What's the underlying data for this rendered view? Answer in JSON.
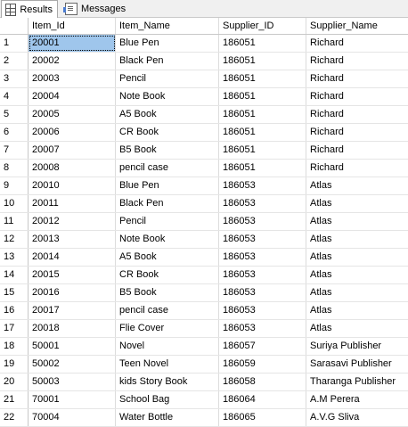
{
  "tabs": [
    {
      "label": "Results",
      "icon": "grid-icon",
      "active": true
    },
    {
      "label": "Messages",
      "icon": "messages-icon",
      "active": false
    }
  ],
  "table": {
    "columns": [
      "",
      "Item_Id",
      "Item_Name",
      "Supplier_ID",
      "Supplier_Name"
    ],
    "rows": [
      [
        "1",
        "20001",
        "Blue Pen",
        "186051",
        "Richard"
      ],
      [
        "2",
        "20002",
        "Black Pen",
        "186051",
        "Richard"
      ],
      [
        "3",
        "20003",
        "Pencil",
        "186051",
        "Richard"
      ],
      [
        "4",
        "20004",
        "Note Book",
        "186051",
        "Richard"
      ],
      [
        "5",
        "20005",
        "A5 Book",
        "186051",
        "Richard"
      ],
      [
        "6",
        "20006",
        "CR Book",
        "186051",
        "Richard"
      ],
      [
        "7",
        "20007",
        "B5 Book",
        "186051",
        "Richard"
      ],
      [
        "8",
        "20008",
        "pencil case",
        "186051",
        "Richard"
      ],
      [
        "9",
        "20010",
        "Blue Pen",
        "186053",
        "Atlas"
      ],
      [
        "10",
        "20011",
        "Black Pen",
        "186053",
        "Atlas"
      ],
      [
        "11",
        "20012",
        "Pencil",
        "186053",
        "Atlas"
      ],
      [
        "12",
        "20013",
        "Note Book",
        "186053",
        "Atlas"
      ],
      [
        "13",
        "20014",
        "A5 Book",
        "186053",
        "Atlas"
      ],
      [
        "14",
        "20015",
        "CR Book",
        "186053",
        "Atlas"
      ],
      [
        "15",
        "20016",
        "B5 Book",
        "186053",
        "Atlas"
      ],
      [
        "16",
        "20017",
        "pencil case",
        "186053",
        "Atlas"
      ],
      [
        "17",
        "20018",
        "Flie Cover",
        "186053",
        "Atlas"
      ],
      [
        "18",
        "50001",
        "Novel",
        "186057",
        "Suriya Publisher"
      ],
      [
        "19",
        "50002",
        "Teen Novel",
        "186059",
        "Sarasavi Publisher"
      ],
      [
        "20",
        "50003",
        "kids Story Book",
        "186058",
        "Tharanga Publisher"
      ],
      [
        "21",
        "70001",
        "School Bag",
        "186064",
        "A.M Perera"
      ],
      [
        "22",
        "70004",
        "Water Bottle",
        "186065",
        "A.V.G Sliva"
      ]
    ],
    "selected_cell": {
      "row": 0,
      "col": 1
    },
    "selected_color": "#9fc6ec"
  }
}
